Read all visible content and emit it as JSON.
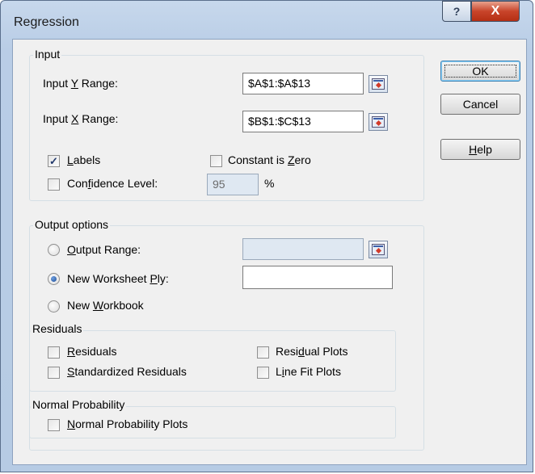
{
  "window": {
    "title": "Regression",
    "help_glyph": "?",
    "close_glyph": "X"
  },
  "input_group": {
    "legend": "Input",
    "y_range_label_pre": "Input ",
    "y_range_label_key": "Y",
    "y_range_label_post": " Range:",
    "y_range_value": "$A$1:$A$13",
    "x_range_label_pre": "Input ",
    "x_range_label_key": "X",
    "x_range_label_post": " Range:",
    "x_range_value": "$B$1:$C$13",
    "labels": {
      "key": "L",
      "rest": "abels",
      "checked": true
    },
    "constant_zero": {
      "pre": "Constant is ",
      "key": "Z",
      "post": "ero",
      "checked": false
    },
    "confidence": {
      "pre": "Con",
      "key": "f",
      "post": "idence Level:",
      "checked": false,
      "value": "95",
      "unit": "%"
    }
  },
  "output_group": {
    "legend": "Output options",
    "output_range": {
      "key": "O",
      "rest": "utput Range:",
      "selected": false,
      "value": ""
    },
    "new_worksheet": {
      "pre": "New Worksheet ",
      "key": "P",
      "post": "ly:",
      "selected": true,
      "value": ""
    },
    "new_workbook": {
      "pre": "New ",
      "key": "W",
      "post": "orkbook",
      "selected": false
    }
  },
  "residuals_group": {
    "legend": "Residuals",
    "residuals": {
      "key": "R",
      "rest": "esiduals",
      "checked": false
    },
    "standardized": {
      "key": "S",
      "rest": "tandardized Residuals",
      "checked": false
    },
    "residual_plots": {
      "pre": "Resi",
      "key": "d",
      "post": "ual Plots",
      "checked": false
    },
    "line_fit": {
      "pre": "L",
      "key": "i",
      "post": "ne Fit Plots",
      "checked": false
    }
  },
  "normal_group": {
    "legend": "Normal Probability",
    "plots": {
      "key": "N",
      "rest": "ormal Probability Plots",
      "checked": false
    }
  },
  "buttons": {
    "ok": "OK",
    "cancel": "Cancel",
    "help_key": "H",
    "help_rest": "elp"
  },
  "check_glyph": "✓"
}
